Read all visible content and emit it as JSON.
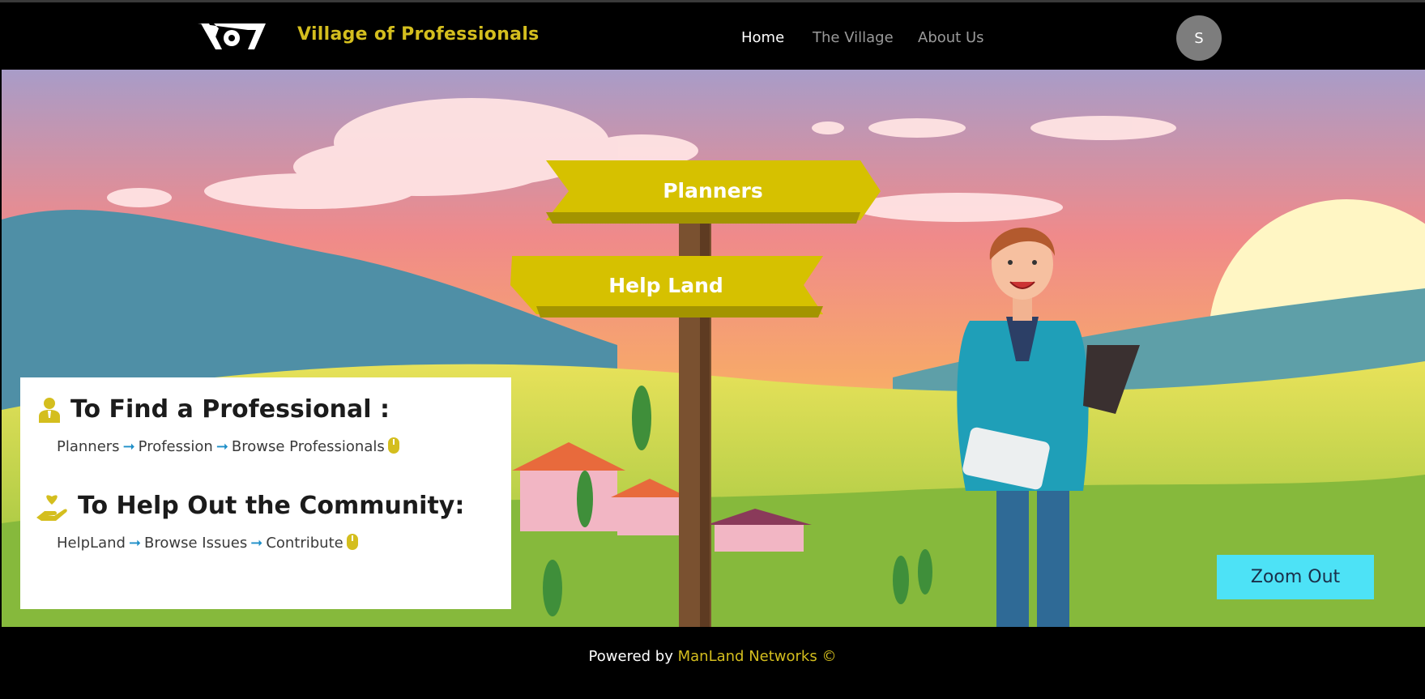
{
  "header": {
    "brand": "Village of Professionals",
    "logo_icon": "vop-logo-icon",
    "nav": [
      {
        "label": "Home",
        "active": true
      },
      {
        "label": "The Village",
        "active": false
      },
      {
        "label": "About Us",
        "active": false
      }
    ],
    "avatar_initial": "S"
  },
  "hero": {
    "signs": [
      "Planners",
      "Help Land"
    ],
    "zoom_button": "Zoom Out",
    "info": {
      "find": {
        "title": "To Find a Professional :",
        "icon": "professional-icon",
        "steps": [
          "Planners",
          "Profession",
          "Browse Professionals"
        ]
      },
      "help": {
        "title": "To Help Out the Community:",
        "icon": "helping-hand-icon",
        "steps": [
          "HelpLand",
          "Browse Issues",
          "Contribute"
        ]
      },
      "arrow": "➞"
    }
  },
  "footer": {
    "prefix": "Powered by ",
    "company": "ManLand Networks ©"
  },
  "colors": {
    "brand": "#d4be1e",
    "sign": "#d6c100",
    "zoom_button": "#4de2f6",
    "arrow": "#1f8fc8"
  }
}
